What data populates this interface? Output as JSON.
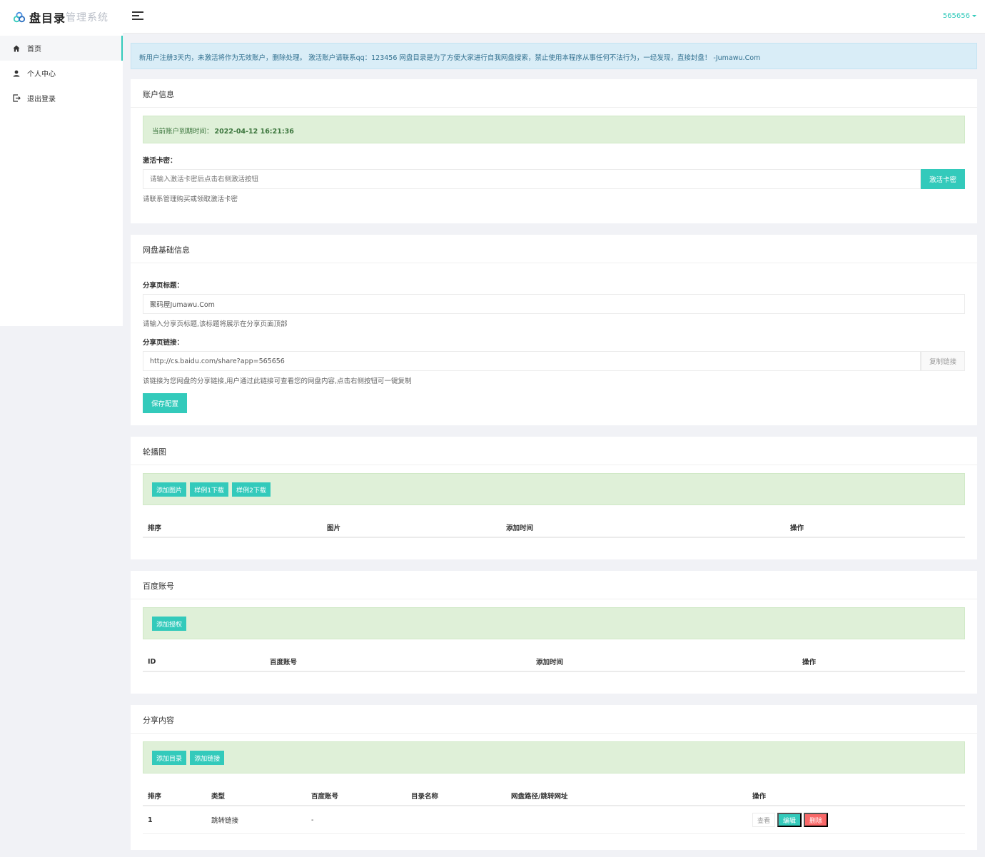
{
  "brand": {
    "main": "盘目录",
    "sub": "管理系统"
  },
  "sidebar": {
    "items": [
      {
        "label": "首页",
        "icon": "home-icon"
      },
      {
        "label": "个人中心",
        "icon": "user-icon"
      },
      {
        "label": "退出登录",
        "icon": "logout-icon"
      }
    ]
  },
  "header": {
    "username": "565656"
  },
  "notice": "新用户注册3天内，未激活将作为无效账户，删除处理。 激活账户请联系qq：123456 网盘目录是为了方便大家进行自我网盘搜索，禁止使用本程序从事任何不法行为，一经发现，直接封盘！ -Jumawu.Com",
  "account": {
    "title": "账户信息",
    "expiry_label": "当前账户到期时间：",
    "expiry_value": "2022-04-12 16:21:36",
    "card_label": "激活卡密：",
    "card_placeholder": "请输入激活卡密后点击右侧激活按钮",
    "activate_button": "激活卡密",
    "help": "请联系管理购买或领取激活卡密"
  },
  "basic": {
    "title": "网盘基础信息",
    "share_title_label": "分享页标题：",
    "share_title_value": "聚码屋Jumawu.Com",
    "share_title_help": "请输入分享页标题,该标题将展示在分享页面顶部",
    "share_link_label": "分享页链接：",
    "share_link_value": "http://cs.baidu.com/share?app=565656",
    "copy_button": "复制链接",
    "share_link_help": "该链接为您网盘的分享链接,用户通过此链接可查看您的网盘内容,点击右侧按钮可一键复制",
    "save_button": "保存配置"
  },
  "carousel": {
    "title": "轮播图",
    "buttons": [
      "添加图片",
      "样例1下载",
      "样例2下载"
    ],
    "columns": [
      "排序",
      "图片",
      "添加时间",
      "操作"
    ]
  },
  "baidu": {
    "title": "百度账号",
    "buttons": [
      "添加授权"
    ],
    "columns": [
      "ID",
      "百度账号",
      "添加时间",
      "操作"
    ]
  },
  "share": {
    "title": "分享内容",
    "buttons": [
      "添加目录",
      "添加链接"
    ],
    "columns": [
      "排序",
      "类型",
      "百度账号",
      "目录名称",
      "网盘路径/跳转网址",
      "操作"
    ],
    "rows": [
      {
        "order": "1",
        "type": "跳转链接",
        "account": "-",
        "name": "",
        "path": "",
        "actions": [
          "查看",
          "编辑",
          "删除"
        ]
      }
    ]
  },
  "colors": {
    "accent": "#33cabb",
    "danger": "#f96868",
    "info_bg": "#d9edf7",
    "success_bg": "#dff0d8"
  }
}
